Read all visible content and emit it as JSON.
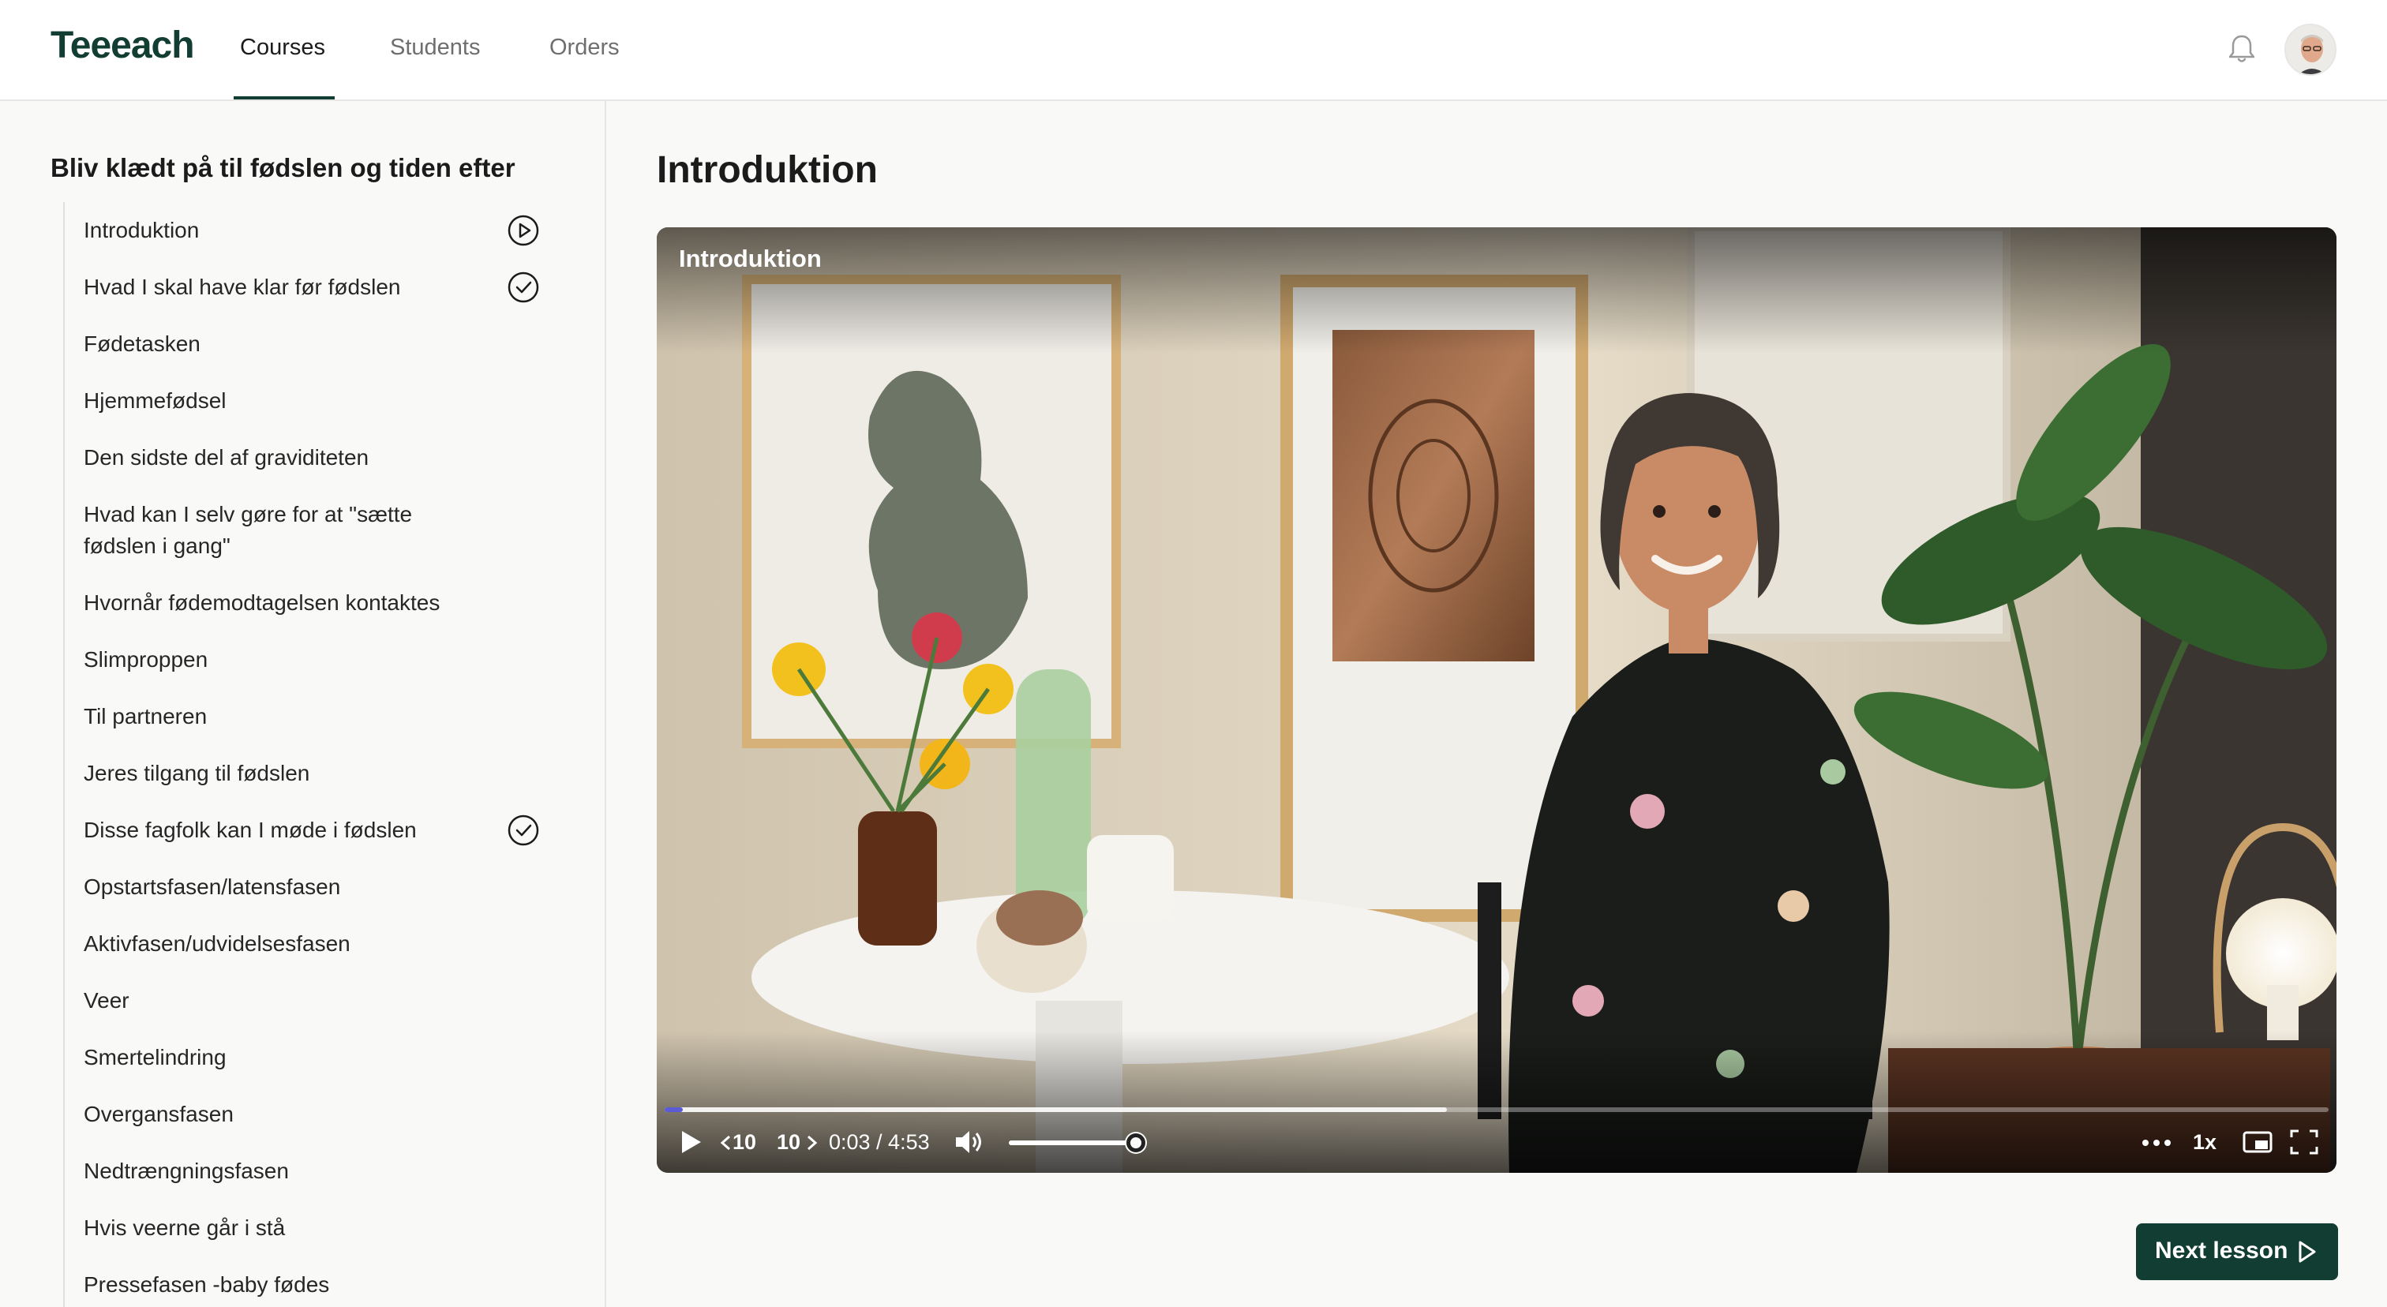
{
  "app": {
    "logo": "Teeeach"
  },
  "nav": {
    "tabs": [
      {
        "label": "Courses",
        "active": true
      },
      {
        "label": "Students",
        "active": false
      },
      {
        "label": "Orders",
        "active": false
      }
    ],
    "icons": [
      "bell-icon",
      "avatar"
    ]
  },
  "sidebar": {
    "course_title": "Bliv klædt på til fødslen og tiden efter",
    "lessons": [
      {
        "label": "Introduktion",
        "status": "playing"
      },
      {
        "label": "Hvad I skal have klar før fødslen",
        "status": "completed"
      },
      {
        "label": "Fødetasken",
        "status": ""
      },
      {
        "label": "Hjemmefødsel",
        "status": ""
      },
      {
        "label": "Den sidste del af graviditeten",
        "status": ""
      },
      {
        "label": "Hvad kan I selv gøre for at \"sætte fødslen i gang\"",
        "status": ""
      },
      {
        "label": "Hvornår fødemodtagelsen kontaktes",
        "status": ""
      },
      {
        "label": "Slimproppen",
        "status": ""
      },
      {
        "label": "Til partneren",
        "status": ""
      },
      {
        "label": "Jeres tilgang til fødslen",
        "status": ""
      },
      {
        "label": "Disse fagfolk kan I møde i fødslen",
        "status": "completed"
      },
      {
        "label": "Opstartsfasen/latensfasen",
        "status": ""
      },
      {
        "label": "Aktivfasen/udvidelsesfasen",
        "status": ""
      },
      {
        "label": "Veer",
        "status": ""
      },
      {
        "label": "Smertelindring",
        "status": ""
      },
      {
        "label": "Overgansfasen",
        "status": ""
      },
      {
        "label": "Nedtrængningsfasen",
        "status": ""
      },
      {
        "label": "Hvis veerne går i stå",
        "status": ""
      },
      {
        "label": "Pressefasen -baby fødes",
        "status": ""
      }
    ]
  },
  "main": {
    "page_title": "Introduktion",
    "player": {
      "video_title": "Introduktion",
      "time_display": "0:03 / 4:53",
      "progress_played": 0.011,
      "progress_buffered": 0.47,
      "volume": 0.9,
      "skip_back_label": "10",
      "skip_forward_label": "10",
      "speed_label": "1x",
      "icons": [
        "play-icon",
        "skip-back-icon",
        "skip-forward-icon",
        "volume-icon",
        "more-icon",
        "pip-icon",
        "fullscreen-icon"
      ]
    },
    "next_button_label": "Next lesson"
  },
  "colors": {
    "brand": "#123d33",
    "progress": "#5b5bd6",
    "background": "#f9f9f8"
  }
}
